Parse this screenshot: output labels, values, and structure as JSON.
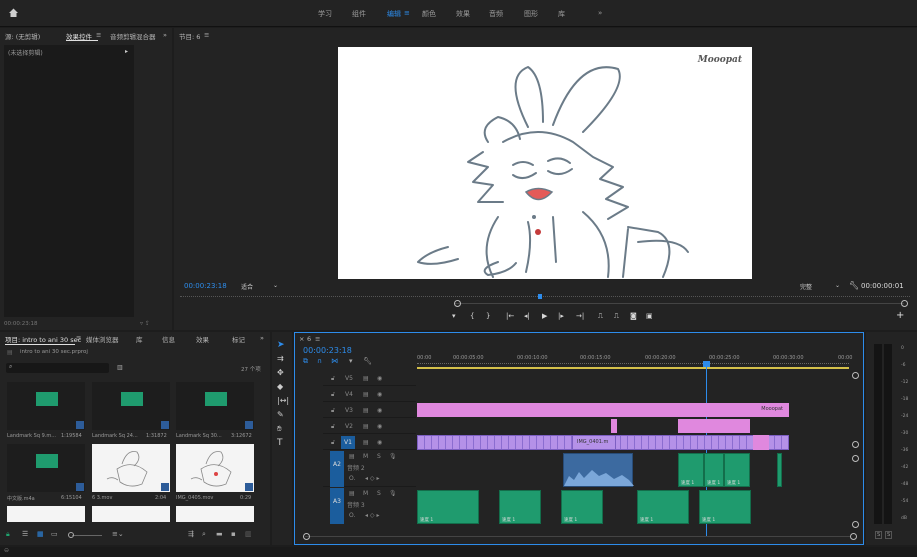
{
  "top_tabs": [
    "学习",
    "组件",
    "编辑",
    "颜色",
    "效果",
    "音频",
    "图形",
    "库"
  ],
  "active_tab": "编辑",
  "more_icon": "»",
  "home_icon": "home-icon",
  "source_panel": {
    "tab_source": "源: (无剪辑)",
    "tab_effects": "效果控件",
    "tab_mixer": "音频剪辑混合器",
    "more": "»",
    "no_clip": "(未选择剪辑)",
    "timecode": "00:00:23:18"
  },
  "program_panel": {
    "title": "节目: 6",
    "timecode": "00:00:23:18",
    "fit": "适合",
    "quality": "完整",
    "duration": "00:00:00:01",
    "watermark": "Mooopat"
  },
  "project_panel": {
    "tabs": [
      "项目: intro to ani 30 sec",
      "媒体浏览器",
      "库",
      "信息",
      "效果",
      "标记"
    ],
    "file": "intro to ani 30 sec.prproj",
    "count": "27 个项",
    "items": [
      {
        "name": "Landmark Sq 9.m...",
        "dur": "1:19584"
      },
      {
        "name": "Landmark Sq 24...",
        "dur": "1:31872"
      },
      {
        "name": "Landmark Sq 30...",
        "dur": "3:12672"
      },
      {
        "name": "中文版.m4a",
        "dur": "6:15104"
      },
      {
        "name": "6 3.mov",
        "dur": "2:04"
      },
      {
        "name": "IMG_0405.mov",
        "dur": "0:29"
      }
    ]
  },
  "timeline": {
    "sequence": "6",
    "timecode": "00:00:23:18",
    "ruler": [
      "00:00",
      "00:00:05:00",
      "00:00:10:00",
      "00:00:15:00",
      "00:00:20:00",
      "00:00:25:00",
      "00:00:30:00",
      "00:00"
    ],
    "video_tracks": [
      "V5",
      "V4",
      "V3",
      "V2",
      "V1"
    ],
    "audio_tracks": [
      {
        "id": "A2",
        "name": "音频 2"
      },
      {
        "id": "A3",
        "name": "音频 3"
      }
    ],
    "clip_labels": {
      "mooopat": "Mooopat",
      "img": "IMG_0401.m",
      "a2_clip1": "速度 1",
      "a2_clip2": "速度 1",
      "a2_clip3": "速度 1",
      "a3_clip1": "速度 1",
      "a3_clip2": "速度 1",
      "a3_clip3": "速度 1",
      "a3_clip4": "速度 1",
      "a3_clip5": "速度 1"
    }
  },
  "meter_labels": [
    "0",
    "-6",
    "-12",
    "-18",
    "-24",
    "-30",
    "-36",
    "-42",
    "-48",
    "-54",
    "dB"
  ],
  "meter_ss": [
    "S",
    "S"
  ],
  "colors": {
    "accent": "#2d8ceb",
    "video_clip": "#b591e8",
    "pink_clip": "#e088de",
    "audio_clip": "#1f9b6e"
  }
}
